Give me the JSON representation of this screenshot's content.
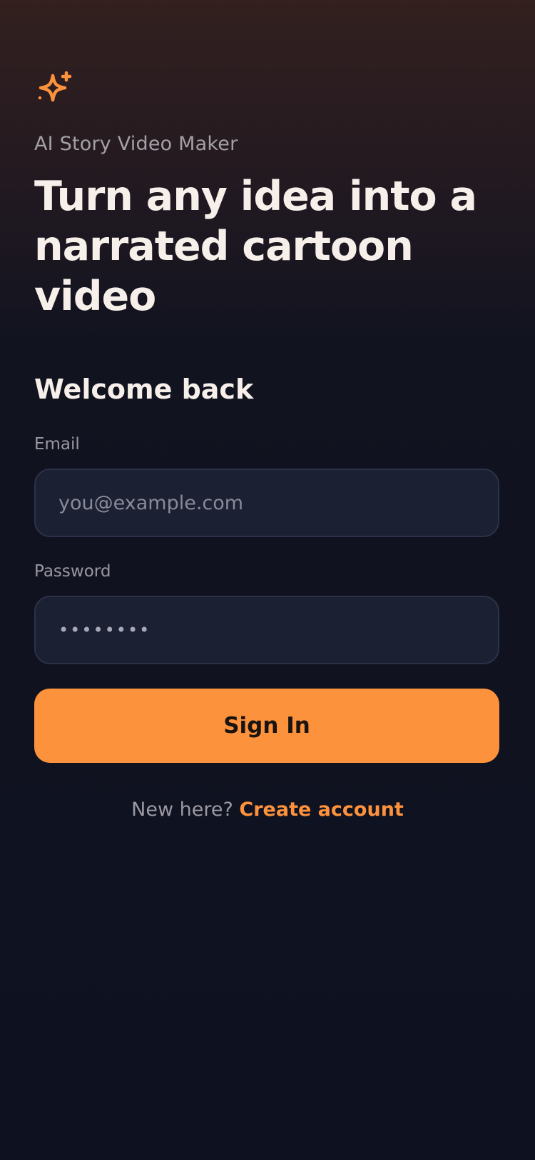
{
  "brand": {
    "icon": "sparkle-icon",
    "accent_color": "#fd923d",
    "app_name": "AI Story Video Maker"
  },
  "hero": {
    "title": "Turn any idea into a narrated cartoon video"
  },
  "login": {
    "heading": "Welcome back",
    "email": {
      "label": "Email",
      "placeholder": "you@example.com",
      "value": ""
    },
    "password": {
      "label": "Password",
      "value": "••••••••"
    },
    "submit_label": "Sign In"
  },
  "signup": {
    "prompt": "New here?",
    "link_label": "Create account"
  }
}
